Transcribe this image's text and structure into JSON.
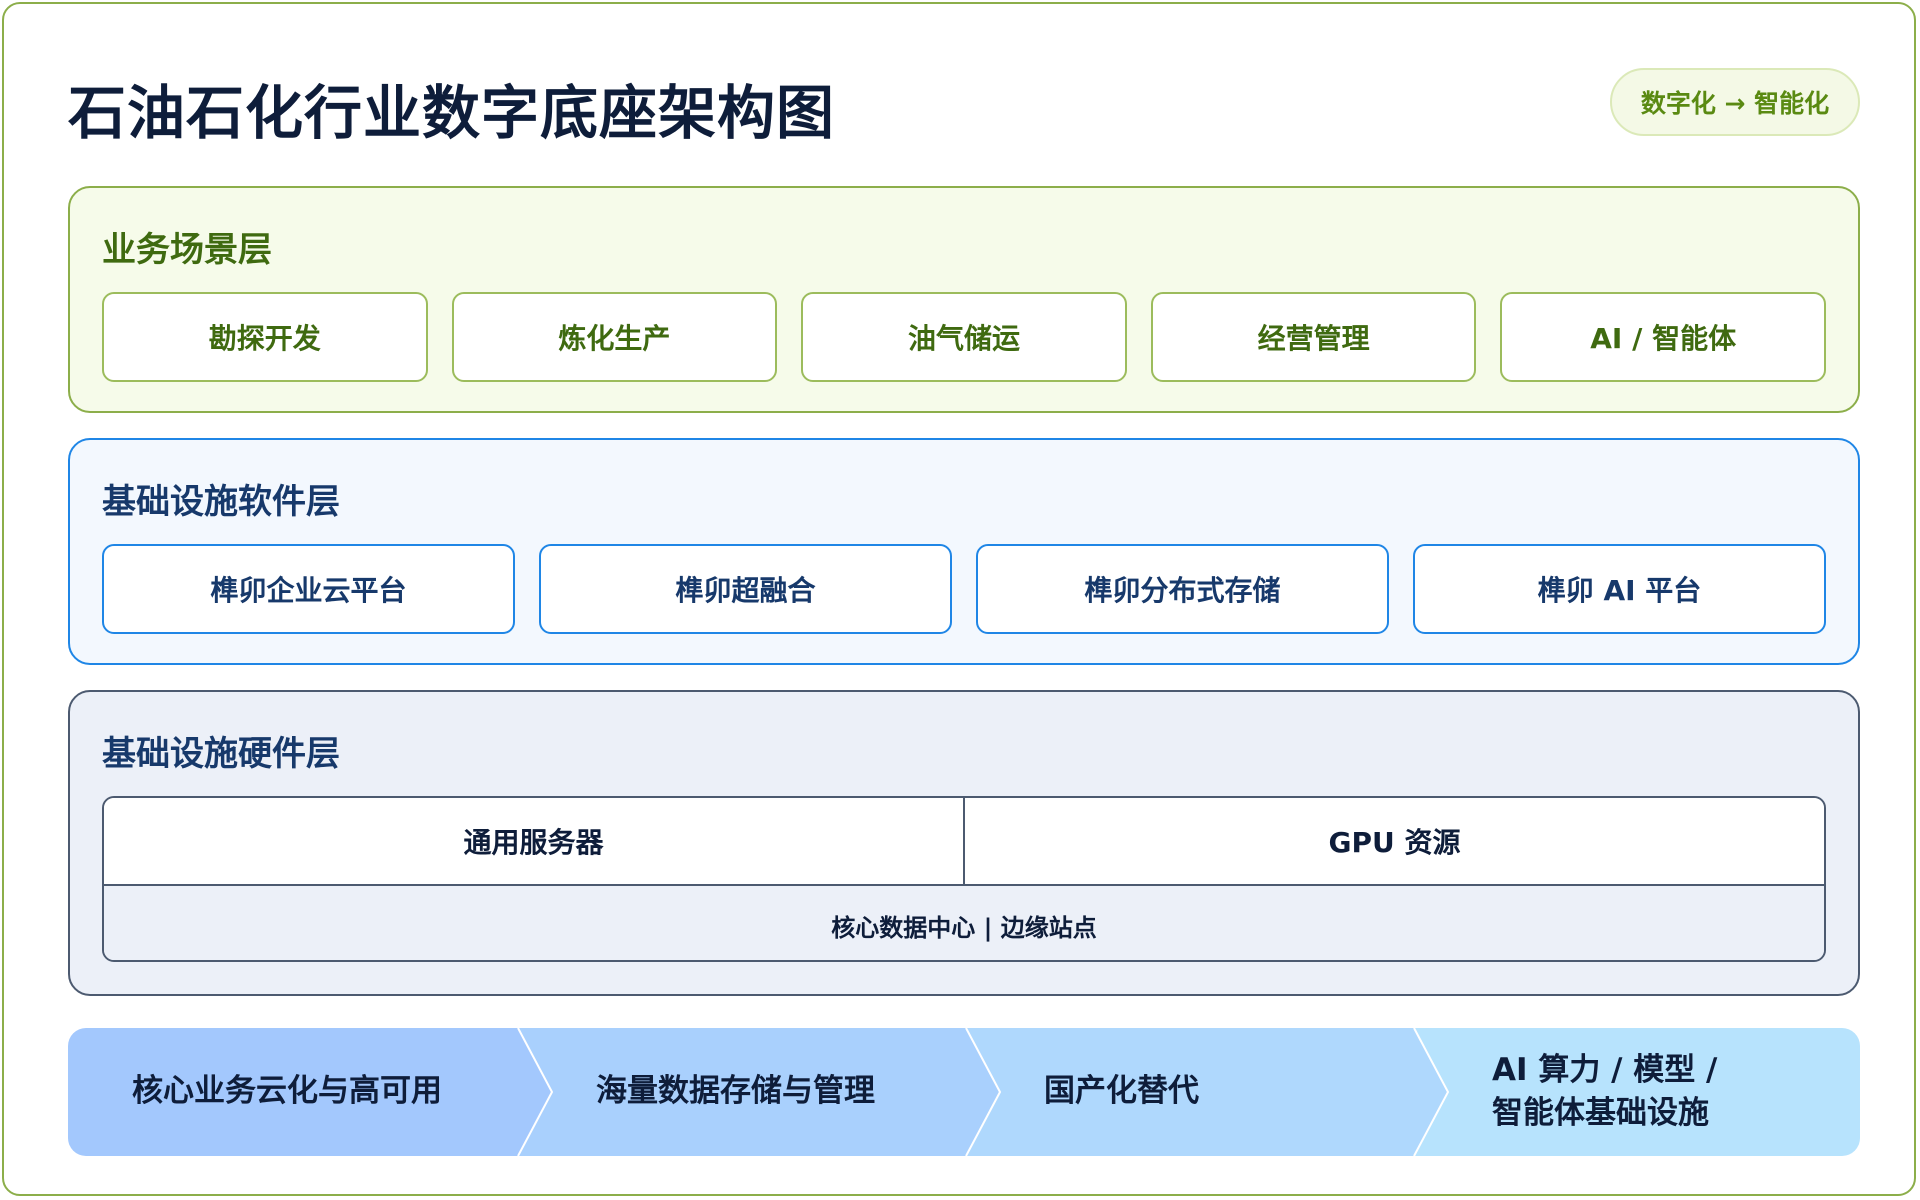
{
  "title": "石油石化行业数字底座架构图",
  "badge": "数字化 → 智能化",
  "business_layer": {
    "title": "业务场景层",
    "items": [
      "勘探开发",
      "炼化生产",
      "油气储运",
      "经营管理",
      "AI / 智能体"
    ]
  },
  "software_layer": {
    "title": "基础设施软件层",
    "items": [
      "榫卯企业云平台",
      "榫卯超融合",
      "榫卯分布式存储",
      "榫卯 AI 平台"
    ]
  },
  "hardware_layer": {
    "title": "基础设施硬件层",
    "items": [
      "通用服务器",
      "GPU 资源"
    ],
    "footer": "核心数据中心 | 边缘站点"
  },
  "flow": {
    "steps": [
      {
        "line1": "核心业务云化与高可用",
        "line2": ""
      },
      {
        "line1": "海量数据存储与管理",
        "line2": ""
      },
      {
        "line1": "国产化替代",
        "line2": ""
      },
      {
        "line1": "AI 算力 / 模型 /",
        "line2": "智能体基础设施"
      }
    ],
    "colors": [
      "#a3c8fd",
      "#a9d0fd",
      "#afd8fd",
      "#b7e3fd"
    ]
  }
}
